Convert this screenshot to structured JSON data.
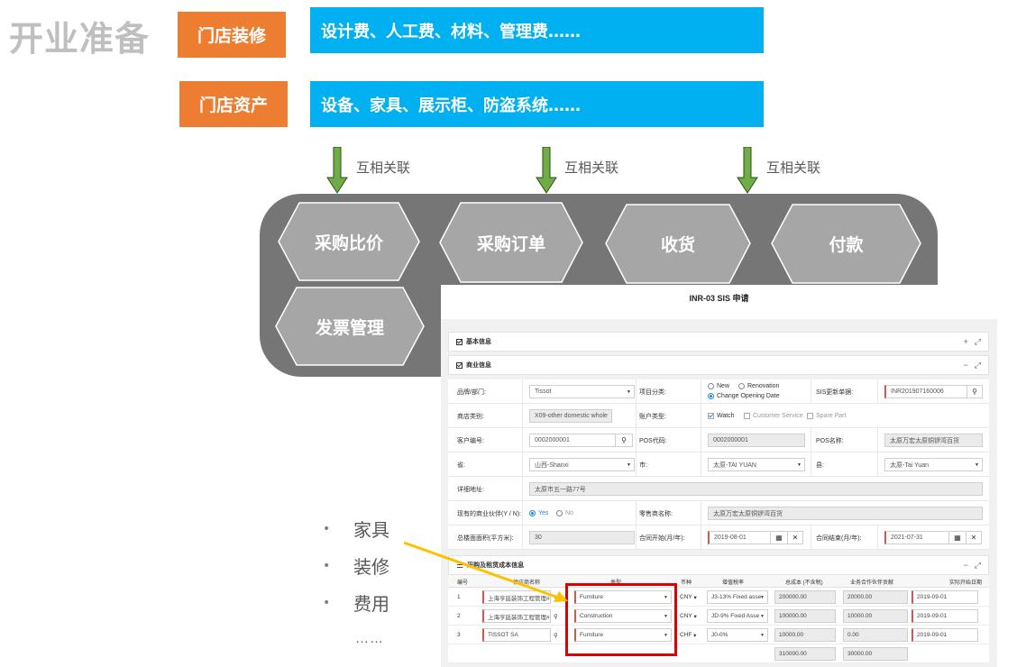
{
  "slide": {
    "title": "开业准备",
    "rows": [
      {
        "tag": "门店装修",
        "desc": "设计费、人工费、材料、管理费……"
      },
      {
        "tag": "门店资产",
        "desc": "设备、家具、展示柜、防盗系统……"
      }
    ],
    "arrow_label": "互相关联",
    "process_steps": [
      "采购比价",
      "采购订单",
      "收货",
      "付款",
      "发票管理"
    ],
    "bullets": [
      "家具",
      "装修",
      "费用"
    ],
    "ellipsis": "……",
    "colors": {
      "orange": "#ed7d31",
      "blue": "#00b0f0",
      "process_bg": "#767676",
      "hexagon": "#a6a6a6",
      "arrow_green": "#70ad47",
      "highlight_red": "#e00000",
      "pointer_yellow": "#ffc000"
    }
  },
  "form": {
    "title": "INR-03 SIS 申请",
    "sections": {
      "basic": "基本信息",
      "business": "商业信息",
      "cost": "采购及租赁成本信息"
    },
    "labels": {
      "brand": "品牌/部门:",
      "project_type": "项目分类:",
      "sis_no": "SIS更新单据:",
      "store_type": "商店类别:",
      "account_type": "账户类型:",
      "customer_no": "客户编号:",
      "pos_code": "POS代码:",
      "pos_name": "POS名称:",
      "province": "省:",
      "city": "市:",
      "county": "县:",
      "address": "详细地址:",
      "existing_partner": "现有的商业伙伴(Y / N):",
      "retailer_name": "零售商名称:",
      "area": "总楼面面积(平方米):",
      "contract_start": "合同开始(月/年):",
      "contract_end": "合同结束(月/年):"
    },
    "values": {
      "brand": "Tissot",
      "sis_no": "INR201907160006",
      "store_type": "X09-other domestic whole",
      "customer_no": "0002000001",
      "pos_code": "0002000001",
      "pos_name": "太原万宏太原铜锣湾百货",
      "province": "山西-Shanxi",
      "city": "太原-TAI YUAN",
      "county": "太原-Tai Yuan",
      "address": "太原市五一路77号",
      "retailer_name": "太原万宏太原铜锣湾百货",
      "area": "30",
      "contract_start": "2019-08-01",
      "contract_end": "2021-07-31"
    },
    "options": {
      "project_new": "New",
      "project_renovation": "Renovation",
      "project_change": "Change Opening Date",
      "acct_watch": "Watch",
      "acct_customer_service": "Customer Service",
      "acct_spare_part": "Spare Part",
      "yes": "Yes",
      "no": "No"
    },
    "table": {
      "headers": [
        "编号",
        "供应商名称",
        "类型",
        "币种",
        "增值税率",
        "总成本 (不含税)",
        "业务合作伙伴贡献",
        "实际开始日期"
      ],
      "rows": [
        {
          "no": "1",
          "supplier": "上海亨廷装饰工程管理#",
          "type": "Furniture",
          "currency": "CNY",
          "vat": "J3-13% Fixed asse",
          "cost": "200000.00",
          "contribution": "20000.00",
          "start": "2019-09-01"
        },
        {
          "no": "2",
          "supplier": "上海亨廷装饰工程管理#",
          "type": "Construction",
          "currency": "CNY",
          "vat": "JD-9% Fixed Asse",
          "cost": "100000.00",
          "contribution": "10000.00",
          "start": "2019-09-01"
        },
        {
          "no": "3",
          "supplier": "TISSOT SA",
          "type": "Furniture",
          "currency": "CHF",
          "vat": "J0-0%",
          "cost": "10000.00",
          "contribution": "0.00",
          "start": "2019-09-01"
        }
      ],
      "totals": {
        "cost": "310000.00",
        "contribution": "30000.00"
      }
    }
  }
}
